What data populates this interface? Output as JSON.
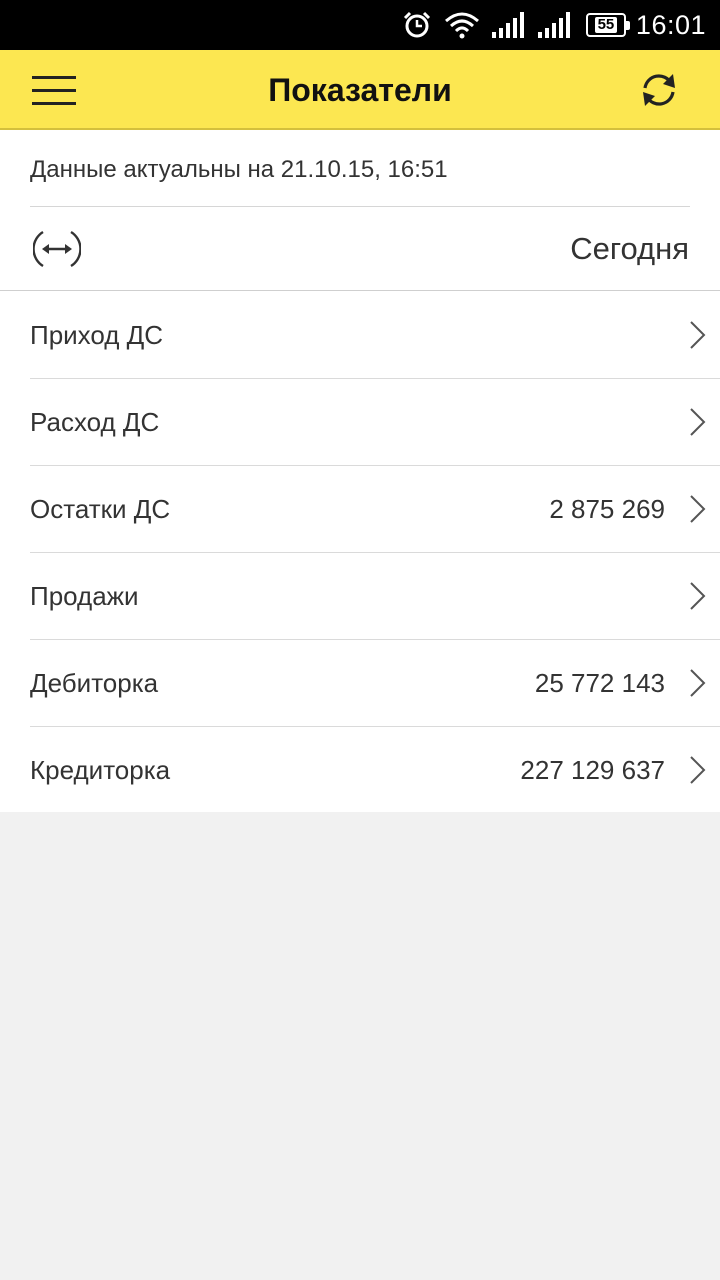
{
  "status_bar": {
    "battery_level": "55",
    "time": "16:01",
    "icons": [
      "alarm-icon",
      "wifi-icon",
      "signal-icon",
      "signal-icon",
      "battery-icon"
    ]
  },
  "app_bar": {
    "title": "Показатели",
    "menu_icon": "hamburger-menu-icon",
    "refresh_icon": "refresh-icon",
    "background_color": "#fce751"
  },
  "updated_text": "Данные актуальны на 21.10.15, 16:51",
  "period": {
    "icon": "period-arrows-icon",
    "label": "Сегодня"
  },
  "indicators": [
    {
      "label": "Приход ДС",
      "value": ""
    },
    {
      "label": "Расход ДС",
      "value": ""
    },
    {
      "label": "Остатки ДС",
      "value": "2 875 269"
    },
    {
      "label": "Продажи",
      "value": ""
    },
    {
      "label": "Дебиторка",
      "value": "25 772 143"
    },
    {
      "label": "Кредиторка",
      "value": "227 129 637"
    }
  ]
}
